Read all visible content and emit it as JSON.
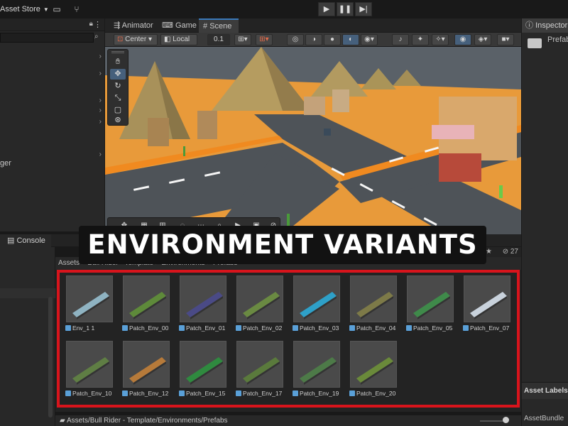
{
  "toolbar": {
    "asset_store_label": "Asset Store",
    "icons": [
      "dropdown-caret-icon",
      "package-icon",
      "branch-icon",
      "play-icon",
      "pause-icon",
      "step-icon"
    ]
  },
  "scene_tabs": [
    {
      "label": "Animator",
      "icon": "animator-icon"
    },
    {
      "label": "Game",
      "icon": "gamepad-icon"
    },
    {
      "label": "Scene",
      "icon": "grid-icon",
      "active": true
    }
  ],
  "scene_toolbar": {
    "pivot_mode": "Center",
    "pivot_rotation": "Local",
    "snap_value": "0.1"
  },
  "hierarchy": {
    "partial_item": "ger"
  },
  "inspector": {
    "tab_label": "Inspector",
    "asset_name": "Prefab",
    "asset_labels_header": "Asset Labels",
    "asset_bundle_label": "AssetBundle"
  },
  "console": {
    "tab_label": "Console"
  },
  "project": {
    "breadcrumb": "Assets > Bull Rider - Template > Environments > Prefabs",
    "hidden_count": "27",
    "bottom_path": "Assets/Bull Rider - Template/Environments/Prefabs",
    "assets": [
      {
        "name": "Env_1 1",
        "color": "#8fb3c2"
      },
      {
        "name": "Patch_Env_00",
        "color": "#5e8a3a"
      },
      {
        "name": "Patch_Env_01",
        "color": "#4a4a86"
      },
      {
        "name": "Patch_Env_02",
        "color": "#6a8a42"
      },
      {
        "name": "Patch_Env_03",
        "color": "#2ea0c8"
      },
      {
        "name": "Patch_Env_04",
        "color": "#7d7a48"
      },
      {
        "name": "Patch_Env_05",
        "color": "#3f8a4a"
      },
      {
        "name": "Patch_Env_07",
        "color": "#c9d2dc"
      },
      {
        "name": "Patch_Env_10",
        "color": "#5f7e44"
      },
      {
        "name": "Patch_Env_12",
        "color": "#b67a3a"
      },
      {
        "name": "Patch_Env_15",
        "color": "#2f8a3f"
      },
      {
        "name": "Patch_Env_17",
        "color": "#5a7a3c"
      },
      {
        "name": "Patch_Env_19",
        "color": "#4d7a48"
      },
      {
        "name": "Patch_Env_20",
        "color": "#6a8a3a"
      }
    ]
  },
  "banner": {
    "text": "ENVIRONMENT VARIANTS"
  },
  "colors": {
    "highlight_frame": "#d8141c",
    "selected_blue": "#3a79bb",
    "sand": "#e89a3a",
    "road": "#4e5358"
  }
}
